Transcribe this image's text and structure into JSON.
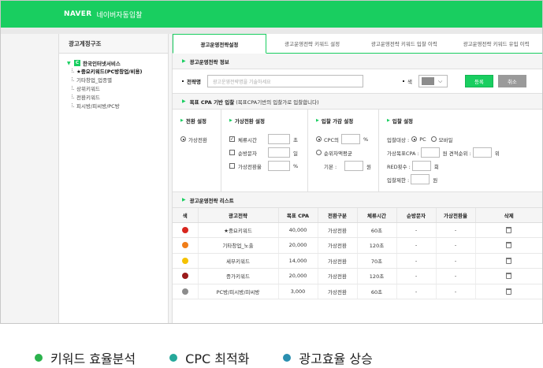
{
  "topbar": {
    "brand": "NAVER",
    "title": "네이버자동입찰"
  },
  "sidebar": {
    "title": "광고계정구조",
    "root": {
      "badge": "C",
      "label": "한국인터넷서비스"
    },
    "items": [
      {
        "label": "★중요키워드(PC방창업/비용)"
      },
      {
        "label": "기타창업_업종별"
      },
      {
        "label": "상위키워드"
      },
      {
        "label": "전환키워드"
      },
      {
        "label": "피시방/피씨방/PC방"
      }
    ]
  },
  "tabs": [
    {
      "label": "광고운영전략설정"
    },
    {
      "label": "광고운영전략 키워드 설정"
    },
    {
      "label": "광고운영전략 키워드 입찰 이력"
    },
    {
      "label": "광고운영전략 키워드 유입 이력"
    }
  ],
  "info_section": {
    "title": "광고운영전략 정보",
    "strategy_label": "전략명",
    "strategy_placeholder": "광고운영전략명을 기술하세요",
    "color_label": "색",
    "register_button": "등록",
    "cancel_button": "취소"
  },
  "goal_section": {
    "title": "목표 CPA 기반 입찰",
    "note": "(목표CPA기반의 입찰가로 입찰합니다)",
    "conversion": {
      "title": "전환 설정",
      "option": "가상전환"
    },
    "virtual": {
      "title": "가상전환 설정",
      "rows": [
        {
          "label": "체류시간",
          "unit": "초",
          "checked": true
        },
        {
          "label": "순방문자",
          "unit": "일",
          "checked": false
        },
        {
          "label": "가상전환율",
          "unit": "%",
          "checked": false
        }
      ]
    },
    "bid_adjust": {
      "title": "입찰 가감 설정",
      "opt1": "CPC의",
      "opt1_unit": "%",
      "opt2": "순위차액평균",
      "base_label": "기본 :",
      "base_unit": "원"
    },
    "bid_settings": {
      "title": "입찰 설정",
      "target_label": "입찰대상 :",
      "target_pc": "PC",
      "target_mobile": "모바일",
      "cpa_label": "가상목표CPA :",
      "cpa_unit": "원",
      "rank_label": "견적순위 :",
      "rank_unit": "위",
      "red_label": "RED횟수 :",
      "red_unit": "회",
      "limit_label": "입찰제한 :",
      "limit_unit": "원"
    }
  },
  "list_section": {
    "title": "광고운영전략 리스트",
    "columns": [
      "색",
      "광고전략",
      "목표 CPA",
      "전환구분",
      "체류시간",
      "순방문자",
      "가상전환율",
      "삭제"
    ],
    "rows": [
      {
        "color": "#d8261e",
        "strategy": "★중요키워드",
        "cpa": "40,000",
        "type": "가상전환",
        "stay": "60초",
        "unique": "-",
        "rate": "-"
      },
      {
        "color": "#f07d18",
        "strategy": "기타창업_노출",
        "cpa": "20,000",
        "type": "가상전환",
        "stay": "120초",
        "unique": "-",
        "rate": "-"
      },
      {
        "color": "#f5c200",
        "strategy": "세부키워드",
        "cpa": "14,000",
        "type": "가상전환",
        "stay": "70초",
        "unique": "-",
        "rate": "-"
      },
      {
        "color": "#9b1b1b",
        "strategy": "증가키워드",
        "cpa": "20,000",
        "type": "가상전환",
        "stay": "120초",
        "unique": "-",
        "rate": "-"
      },
      {
        "color": "#8c8c8c",
        "strategy": "PC방/피시방/피씨방",
        "cpa": "3,000",
        "type": "가상전환",
        "stay": "60초",
        "unique": "-",
        "rate": "-"
      }
    ]
  },
  "legend": [
    {
      "label": "키워드 효율분석",
      "color": "#2bb24c"
    },
    {
      "label": "CPC 최적화",
      "color": "#25a89a"
    },
    {
      "label": "광고효율 상승",
      "color": "#2a8fb0"
    }
  ]
}
